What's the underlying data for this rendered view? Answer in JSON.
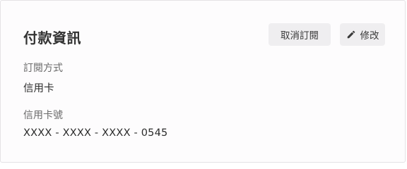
{
  "payment": {
    "title": "付款資訊",
    "cancel_label": "取消訂閱",
    "edit_label": "修改",
    "method_label": "訂閱方式",
    "method_value": "信用卡",
    "card_label": "信用卡號",
    "card_value": "XXXX - XXXX - XXXX - 0545"
  },
  "icons": {
    "edit": "pencil-icon"
  },
  "colors": {
    "button_bg": "#efeef0",
    "card_border": "#e4e2e5",
    "text_primary": "#2b2b2b",
    "text_secondary": "#6a6a6a"
  }
}
